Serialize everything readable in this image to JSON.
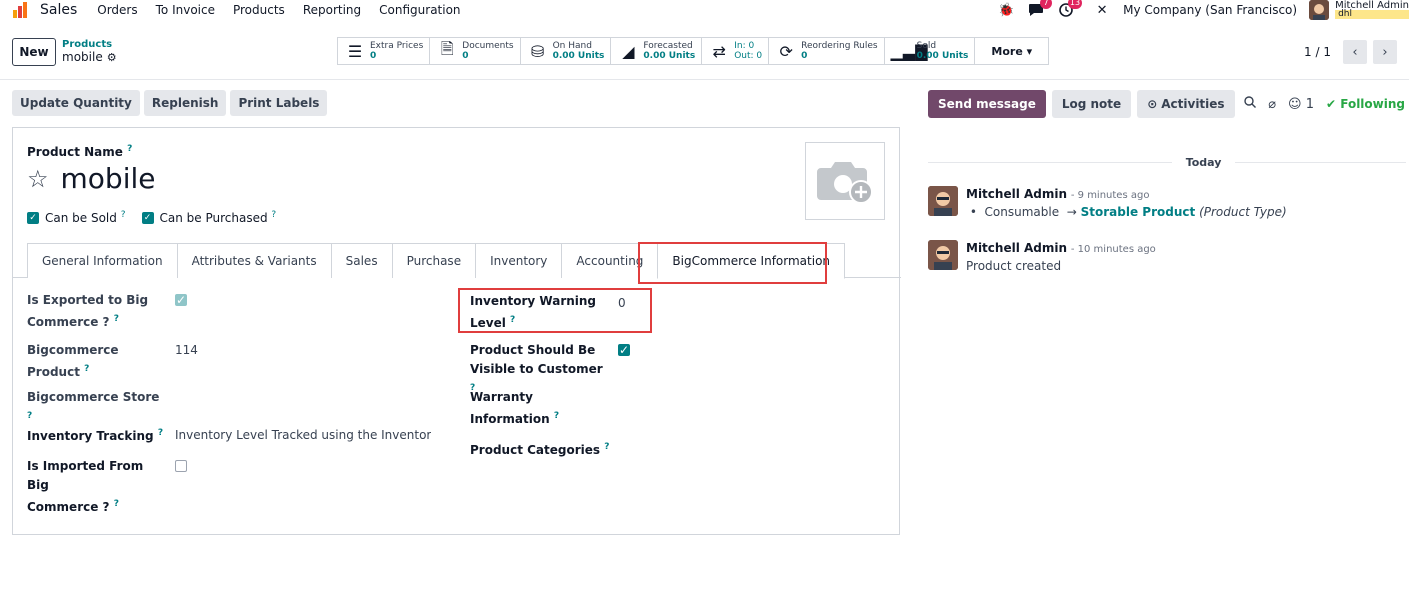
{
  "navbar": {
    "app_name": "Sales",
    "menu": [
      "Orders",
      "To Invoice",
      "Products",
      "Reporting",
      "Configuration"
    ],
    "messages_count": "7",
    "activities_count": "13",
    "company": "My Company (San Francisco)",
    "user_name": "Mitchell Admin",
    "db_name": "dhl"
  },
  "control_panel": {
    "new_label": "New",
    "breadcrumb_parent": "Products",
    "breadcrumb_current": "mobile",
    "smart_buttons": [
      {
        "label": "Extra Prices",
        "value": "0"
      },
      {
        "label": "Documents",
        "value": "0"
      },
      {
        "label": "On Hand",
        "value": "0.00 Units"
      },
      {
        "label": "Forecasted",
        "value": "0.00 Units"
      },
      {
        "label": "In: 0",
        "value": "Out: 0"
      },
      {
        "label": "Reordering Rules",
        "value": "0"
      },
      {
        "label": "Sold",
        "value": "0.00 Units"
      }
    ],
    "more_label": "More",
    "pager": "1 / 1"
  },
  "actions": [
    "Update Quantity",
    "Replenish",
    "Print Labels"
  ],
  "form": {
    "product_name_label": "Product Name",
    "product_name": "mobile",
    "can_be_sold": "Can be Sold",
    "can_be_purchased": "Can be Purchased",
    "tabs": [
      "General Information",
      "Attributes & Variants",
      "Sales",
      "Purchase",
      "Inventory",
      "Accounting",
      "BigCommerce Information"
    ],
    "left_fields": {
      "exported_label_1": "Is Exported to Big",
      "exported_label_2": "Commerce ?",
      "bc_product_label_1": "Bigcommerce",
      "bc_product_label_2": "Product",
      "bc_product_value": "114",
      "bc_store_label": "Bigcommerce Store",
      "inv_tracking_label": "Inventory Tracking",
      "inv_tracking_value": "Inventory Level Tracked using the Inventory L",
      "imported_label_1": "Is Imported From Big",
      "imported_label_2": "Commerce ?"
    },
    "right_fields": {
      "warning_label_1": "Inventory Warning",
      "warning_label_2": "Level",
      "warning_value": "0",
      "visible_label_1": "Product Should Be",
      "visible_label_2": "Visible to Customer",
      "warranty_label_1": "Warranty",
      "warranty_label_2": "Information",
      "categories_label": "Product Categories"
    }
  },
  "chatter": {
    "send_message": "Send message",
    "log_note": "Log note",
    "activities": "Activities",
    "followers_count": "1",
    "following": "Following",
    "today": "Today",
    "messages": [
      {
        "author": "Mitchell Admin",
        "time": "- 9 minutes ago",
        "old_value": "Consumable",
        "new_value": "Storable Product",
        "field": "(Product Type)"
      },
      {
        "author": "Mitchell Admin",
        "time": "- 10 minutes ago",
        "text": "Product created"
      }
    ]
  }
}
